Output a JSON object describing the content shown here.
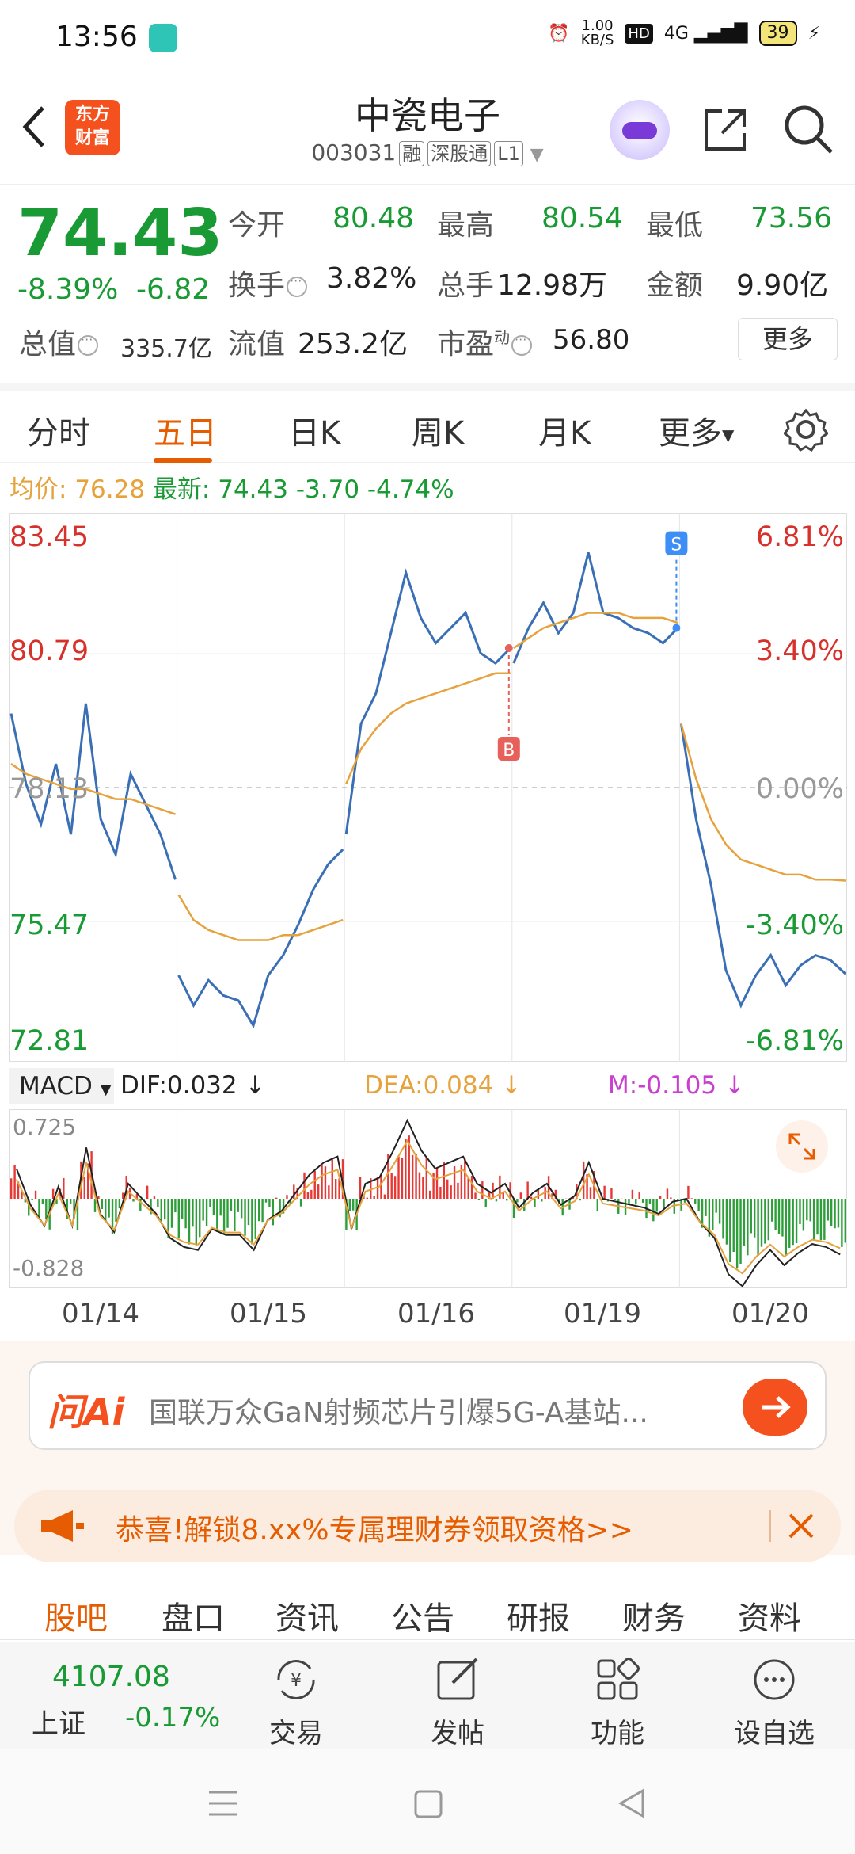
{
  "status": {
    "time": "13:56",
    "net_speed": "1.00\nKB/S",
    "network": "4G",
    "battery": "39"
  },
  "header": {
    "logo_line1": "东方",
    "logo_line2": "财富",
    "title": "中瓷电子",
    "code": "003031",
    "tags": [
      "融",
      "深股通",
      "L1"
    ]
  },
  "quote": {
    "price": "74.43",
    "change_pct": "-8.39%",
    "change": "-6.82",
    "open_label": "今开",
    "open": "80.48",
    "high_label": "最高",
    "high": "80.54",
    "low_label": "最低",
    "low": "73.56",
    "turnover_label": "换手",
    "turnover": "3.82%",
    "volume_label": "总手",
    "volume": "12.98万",
    "amount_label": "金额",
    "amount": "9.90亿",
    "mcap_label": "总值",
    "mcap": "335.7亿",
    "float_label": "流值",
    "float": "253.2亿",
    "pe_label": "市盈",
    "pe_sup": "动",
    "pe": "56.80",
    "more": "更多"
  },
  "tabs": {
    "items": [
      "分时",
      "五日",
      "日K",
      "周K",
      "月K",
      "更多"
    ],
    "active": "五日"
  },
  "summary": {
    "avg_label": "均价:",
    "avg": "76.28",
    "last_label": "最新:",
    "last": "74.43",
    "chg": "-3.70",
    "pct": "-4.74%"
  },
  "chart_data": {
    "type": "line",
    "x": [
      "01/14",
      "01/15",
      "01/16",
      "01/19",
      "01/20"
    ],
    "ylim": [
      72.81,
      83.45
    ],
    "y_ticks_left": [
      "83.45",
      "80.79",
      "78.13",
      "75.47",
      "72.81"
    ],
    "y_ticks_right": [
      "6.81%",
      "3.40%",
      "0.00%",
      "-3.40%",
      "-6.81%"
    ],
    "series": [
      {
        "name": "",
        "color": "#3a6fb5",
        "values": [
          79.6,
          78.2,
          77.4,
          78.6,
          77.2,
          79.8,
          77.5,
          76.8,
          78.4,
          77.8,
          77.2,
          76.3,
          74.4,
          73.8,
          74.3,
          74.0,
          73.9,
          73.4,
          74.4,
          74.8,
          75.4,
          76.1,
          76.6,
          76.9,
          77.2,
          79.4,
          80.0,
          81.2,
          82.4,
          81.5,
          81.0,
          81.3,
          81.6,
          80.8,
          80.6,
          80.9,
          80.6,
          81.3,
          81.8,
          81.2,
          81.6,
          82.8,
          81.6,
          81.5,
          81.3,
          81.2,
          81.0,
          81.3,
          79.4,
          77.5,
          76.2,
          74.5,
          73.8,
          74.4,
          74.8,
          74.2,
          74.6,
          74.8,
          74.7,
          74.43
        ]
      },
      {
        "name": "",
        "color": "#e6a23c",
        "values": [
          78.6,
          78.4,
          78.3,
          78.2,
          78.1,
          78.1,
          78.0,
          77.9,
          77.9,
          77.8,
          77.7,
          77.6,
          76.0,
          75.5,
          75.3,
          75.2,
          75.1,
          75.1,
          75.1,
          75.2,
          75.2,
          75.3,
          75.4,
          75.5,
          78.2,
          78.9,
          79.3,
          79.6,
          79.8,
          79.9,
          80.0,
          80.1,
          80.2,
          80.3,
          80.4,
          80.4,
          80.9,
          81.1,
          81.3,
          81.4,
          81.5,
          81.6,
          81.6,
          81.6,
          81.5,
          81.5,
          81.5,
          81.4,
          79.4,
          78.3,
          77.5,
          77.0,
          76.7,
          76.6,
          76.5,
          76.4,
          76.4,
          76.3,
          76.3,
          76.28
        ]
      }
    ],
    "markers": [
      {
        "label": "B",
        "color": "#e8605a"
      },
      {
        "label": "S",
        "color": "#3e8ef7"
      }
    ]
  },
  "macd": {
    "name": "MACD",
    "dif": "DIF:0.032",
    "dea": "DEA:0.084",
    "m": "M:-0.105",
    "max": "0.725",
    "min": "-0.828"
  },
  "ai": {
    "logo": "问Ai",
    "text": "国联万众GaN射频芯片引爆5G-A基站..."
  },
  "promo": {
    "text": "恭喜!解锁8.xx%专属理财券领取资格>>"
  },
  "bottom_tabs": {
    "items": [
      "股吧",
      "盘口",
      "资讯",
      "公告",
      "研报",
      "财务",
      "资料"
    ],
    "active": "股吧"
  },
  "dock": {
    "index_value": "4107.08",
    "index_name": "上证",
    "index_change": "-0.17%",
    "items": [
      "交易",
      "发帖",
      "功能",
      "设自选"
    ]
  }
}
